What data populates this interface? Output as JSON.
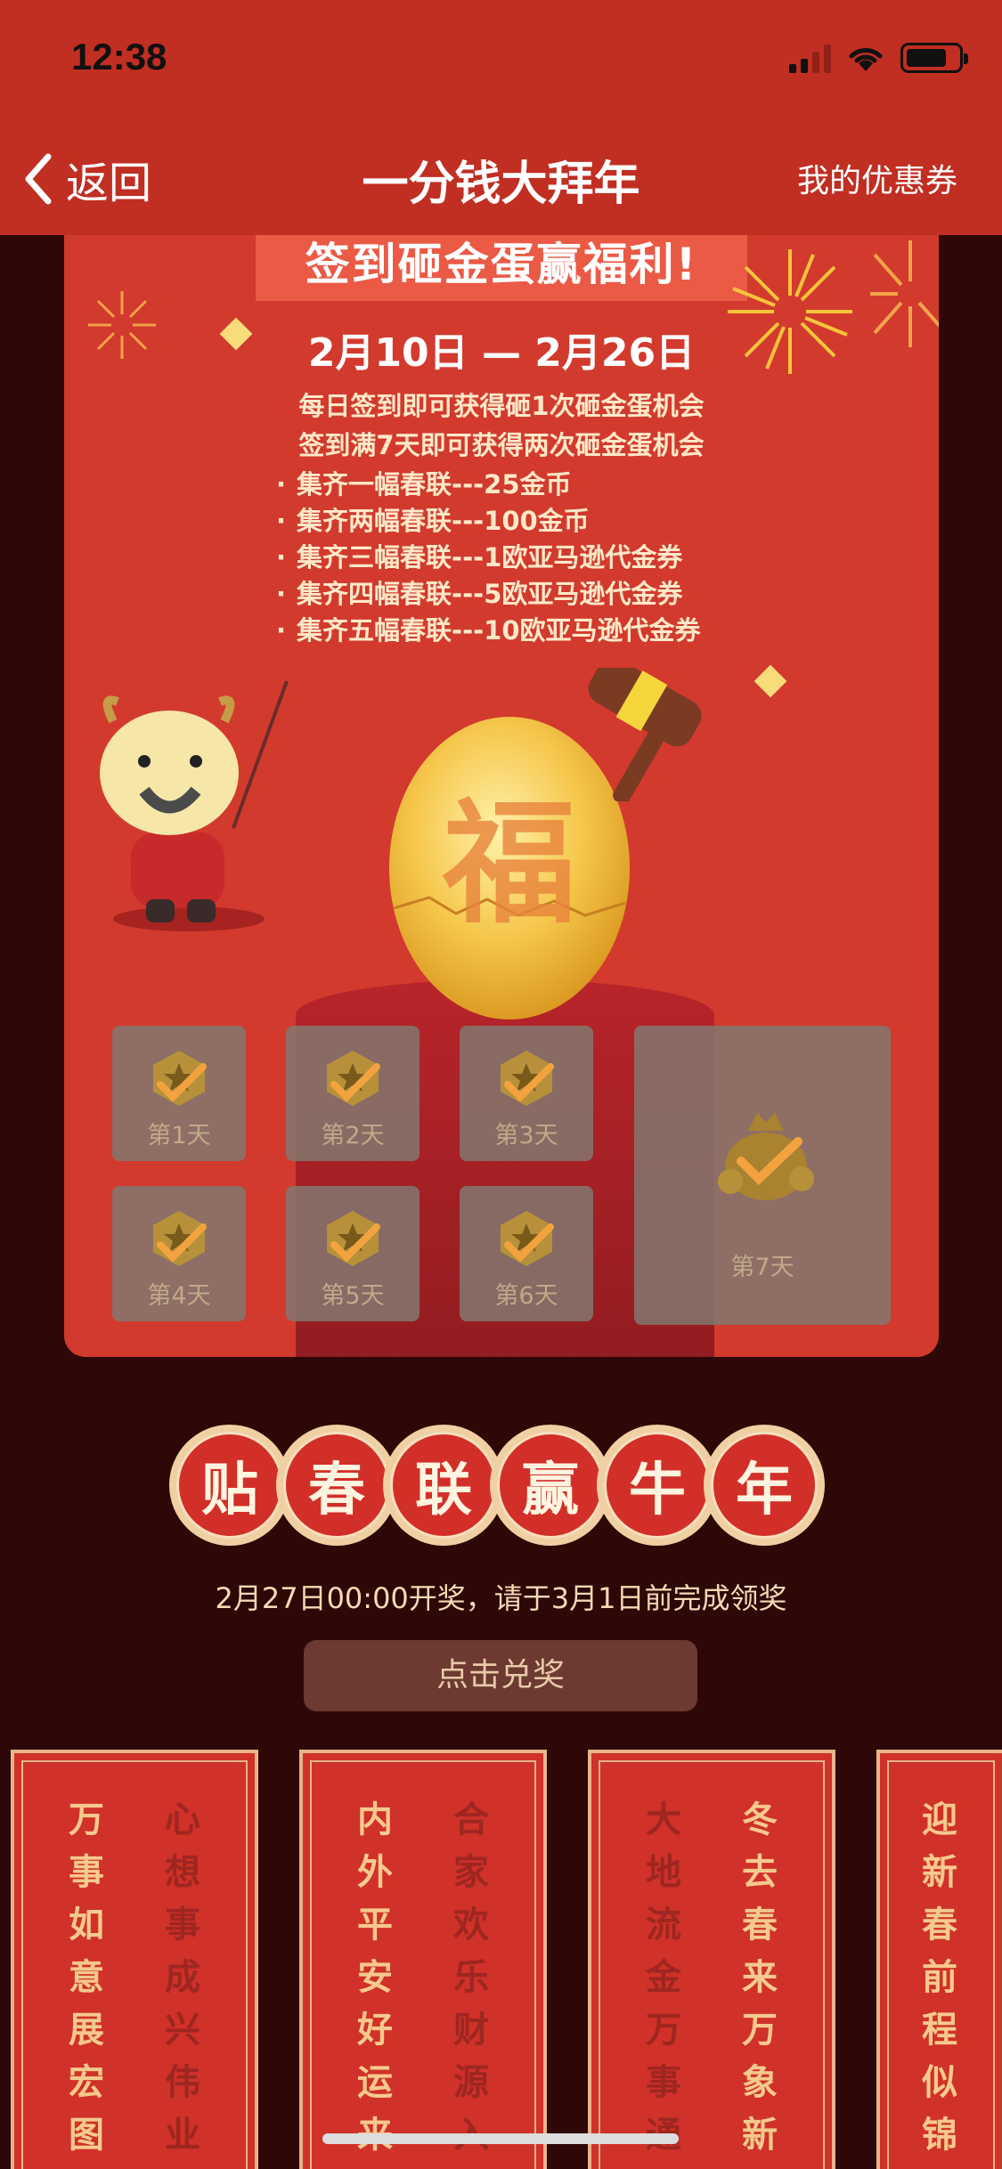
{
  "status_bar": {
    "time": "12:38"
  },
  "nav": {
    "back_label": "返回",
    "title": "一分钱大拜年",
    "right_label": "我的优惠券"
  },
  "poster": {
    "title": "签到砸金蛋赢福利!",
    "dates": "2月10日 — 2月26日",
    "desc_line1": "每日签到即可获得砸1次砸金蛋机会",
    "desc_line2": "签到满7天即可获得两次砸金蛋机会",
    "rewards": [
      "集齐一幅春联---25金币",
      "集齐两幅春联---100金币",
      "集齐三幅春联---1欧亚马逊代金券",
      "集齐四幅春联---5欧亚马逊代金券",
      "集齐五幅春联---10欧亚马逊代金券"
    ],
    "egg_char": "福",
    "days": [
      "第1天",
      "第2天",
      "第3天",
      "第4天",
      "第5天",
      "第6天",
      "第7天"
    ]
  },
  "banner": {
    "chars": [
      "贴",
      "春",
      "联",
      "赢",
      "牛",
      "年"
    ]
  },
  "draw_text": "2月27日00:00开奖，请于3月1日前完成领奖",
  "redeem_button": "点击兑奖",
  "couplets": [
    {
      "a": [
        "万",
        "事",
        "如",
        "意",
        "展",
        "宏",
        "图"
      ],
      "b": [
        "心",
        "想",
        "事",
        "成",
        "兴",
        "伟",
        "业"
      ]
    },
    {
      "a": [
        "内",
        "外",
        "平",
        "安",
        "好",
        "运",
        "来"
      ],
      "b": [
        "合",
        "家",
        "欢",
        "乐",
        "财",
        "源",
        "入"
      ]
    },
    {
      "a": [
        "大",
        "地",
        "流",
        "金",
        "万",
        "事",
        "通"
      ],
      "b": [
        "冬",
        "去",
        "春",
        "来",
        "万",
        "象",
        "新"
      ]
    },
    {
      "a": [
        "迎",
        "新",
        "春",
        "前",
        "程",
        "似",
        "锦"
      ],
      "b": []
    }
  ],
  "colors": {
    "nav_red": "#c12e22",
    "poster_red": "#d23a2e",
    "page_bg": "#2d0807",
    "gold": "#f0cfa3"
  }
}
